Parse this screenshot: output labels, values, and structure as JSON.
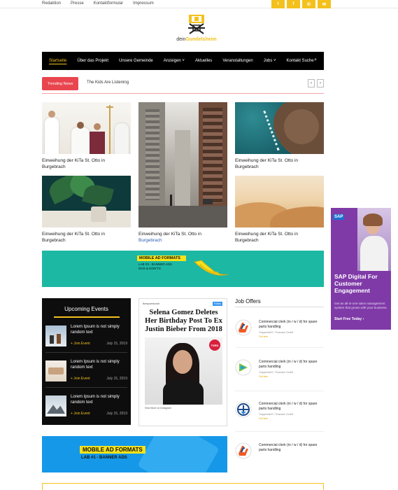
{
  "top_links": [
    "Redaktion",
    "Presse",
    "Kontaktformular",
    "Impressum"
  ],
  "social": [
    {
      "icon": "twitter-icon",
      "glyph": "t"
    },
    {
      "icon": "facebook-icon",
      "glyph": "f"
    },
    {
      "icon": "phone-icon",
      "glyph": "✆"
    },
    {
      "icon": "mail-icon",
      "glyph": "✉"
    }
  ],
  "logo": {
    "prefix": "dein",
    "highlight": "Gundelsheim"
  },
  "nav": {
    "items": [
      "Startseite",
      "Über das Projekt",
      "Unsere Gemeinde",
      "Anzeigen",
      "Aktuelles",
      "Veranstaltungen",
      "Jobs",
      "Kontakt Suche"
    ],
    "dropdown": [
      false,
      false,
      false,
      true,
      false,
      false,
      true,
      false
    ],
    "active": 0
  },
  "trending": {
    "badge": "Trending News",
    "headline": "The Kids Are Listening"
  },
  "grid": [
    {
      "pre": "Einweihung der KiTa St. Otto in",
      "post": "Burgebrach",
      "hl": false
    },
    {
      "pre": "Einweihung der KiTa St. Otto in",
      "post": "Burgebrach",
      "hl": false
    },
    {
      "pre": "Einweihung der KiTa St. Otto in",
      "post": "Burgebrach",
      "hl": false
    },
    {
      "pre": "Einweihung der KiTa St. Otto in",
      "post": "Burgebrach",
      "hl": false
    },
    {
      "pre": "Einweihung der KiTa St. Otto in",
      "post": "Burgebrach",
      "hl": true
    },
    {
      "pre": "Einweihung der KiTa St. Otto in",
      "post": "Burgebrach",
      "hl": false
    }
  ],
  "banner1": {
    "title": "MOBILE AD FORMATS",
    "sub1": "LAB #3 - BANNER ADS",
    "sub2": "DOS & DON'TS"
  },
  "events": {
    "title": "Upcoming Events",
    "items": [
      {
        "title": "Lorem Ipsum is not simply random text",
        "join": "+ Join Event",
        "date": "July 15, 2019"
      },
      {
        "title": "Lorem Ipsum is not simply random text",
        "join": "+ Join Event",
        "date": "July 15, 2019"
      },
      {
        "title": "Lorem Ipsum is not simply random text",
        "join": "+ Join Event",
        "date": "July 15, 2019"
      }
    ]
  },
  "post": {
    "handle": "thesportsrush",
    "follow": "Follow",
    "headline": "Selena Gomez Deletes Her Birthday Post To Ex Justin Bieber From 2018",
    "badge": "TSRD",
    "footer": "View More on Instagram"
  },
  "jobs": {
    "title": "Job Offers",
    "items": [
      {
        "title": "Commercial clerk (m / w / d) for spare parts handling",
        "company": "Troppender© / Thomann GmbH",
        "type": "Full time"
      },
      {
        "title": "Commercial clerk (m / w / d) for spare parts handling",
        "company": "Troppender© / Thomann GmbH",
        "type": "Full time"
      },
      {
        "title": "Commercial clerk (m / w / d) for spare parts handling",
        "company": "Troppender© / Thomann GmbH",
        "type": "Full time"
      },
      {
        "title": "Commercial clerk (m / w / d) for spare parts handling",
        "company": "",
        "type": ""
      }
    ]
  },
  "banner2": {
    "title": "MOBILE AD FORMATS",
    "sub": "LAB #1 - BANNER ADS"
  },
  "side_ad": {
    "brand": "SAP",
    "headline": "SAP Digital For Customer Engagement",
    "body": "Get an all-in-one sales management system that grows with your business.",
    "cta": "Start Free Today ›"
  },
  "colors": {
    "accent": "#f4c11c",
    "trend": "#e9454f",
    "nav_bg": "#000000",
    "teal": "#1cb8a4",
    "blue": "#1598e8",
    "sap": "#7f3aa8"
  }
}
